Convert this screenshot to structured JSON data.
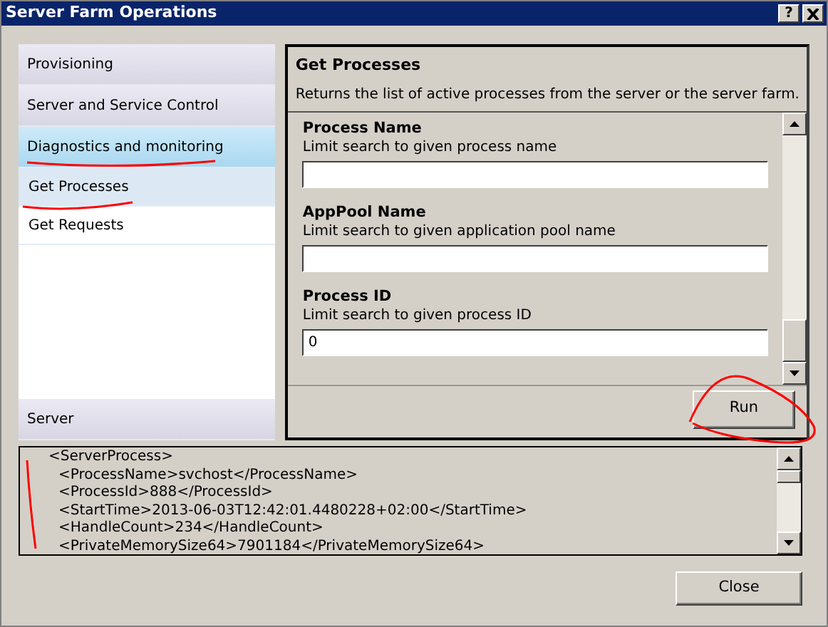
{
  "window": {
    "title": "Server Farm Operations",
    "help": "?"
  },
  "sidebar": {
    "items": [
      {
        "label": "Provisioning",
        "selected": false
      },
      {
        "label": "Server and Service Control",
        "selected": false
      },
      {
        "label": "Diagnostics and monitoring",
        "selected": true,
        "children": [
          {
            "label": "Get Processes",
            "selected": true
          },
          {
            "label": "Get Requests",
            "selected": false
          }
        ]
      }
    ],
    "bottom_items": [
      {
        "label": "Server",
        "selected": false
      }
    ]
  },
  "panel": {
    "title": "Get Processes",
    "description": "Returns the list of active processes from the server or the server farm.",
    "fields": [
      {
        "label": "Process Name",
        "hint": "Limit search to given process name"
      },
      {
        "label": "AppPool Name",
        "hint": "Limit search to given application pool name"
      },
      {
        "label": "Process ID",
        "hint": "Limit search to given process ID",
        "value": "0"
      }
    ],
    "run_button": "Run"
  },
  "output": {
    "lines": [
      {
        "text": "<ServerProcess>",
        "indent": false
      },
      {
        "text": "<ProcessName>svchost</ProcessName>",
        "indent": true
      },
      {
        "text": "<ProcessId>888</ProcessId>",
        "indent": true
      },
      {
        "text": "<StartTime>2013-06-03T12:42:01.4480228+02:00</StartTime>",
        "indent": true
      },
      {
        "text": "<HandleCount>234</HandleCount>",
        "indent": true
      },
      {
        "text": "<PrivateMemorySize64>7901184</PrivateMemorySize64>",
        "indent": true
      }
    ]
  },
  "close_button": "Close"
}
